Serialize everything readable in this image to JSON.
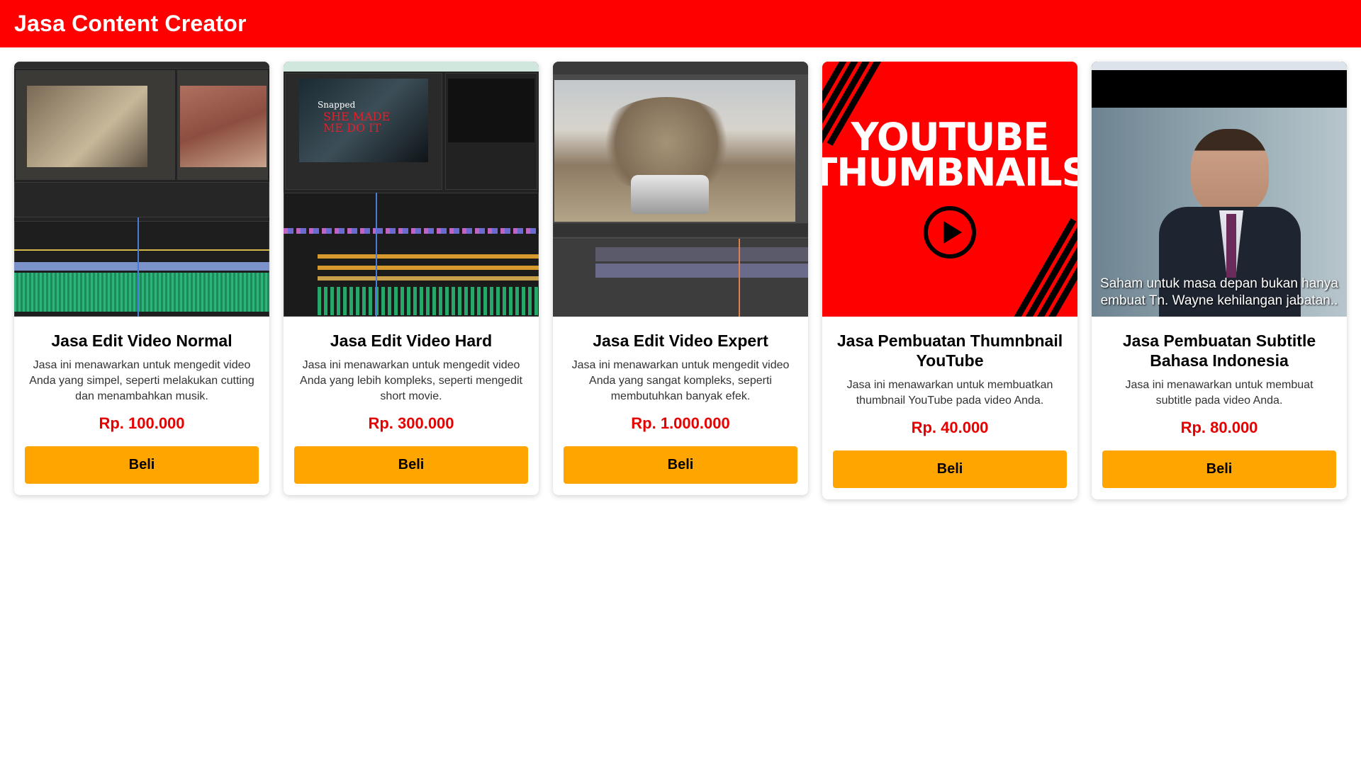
{
  "header": {
    "title": "Jasa Content Creator"
  },
  "colors": {
    "brand": "#ff0000",
    "price": "#e60000",
    "button": "#ffa500"
  },
  "products": [
    {
      "title": "Jasa Edit Video Normal",
      "description": "Jasa ini menawarkan untuk mengedit video Anda yang simpel, seperti melakukan cutting dan menambahkan musik.",
      "price": "Rp. 100.000",
      "button": "Beli",
      "image": "video-editor-screenshot"
    },
    {
      "title": "Jasa Edit Video Hard",
      "description": "Jasa ini menawarkan untuk mengedit video Anda yang lebih kompleks, seperti mengedit short movie.",
      "price": "Rp. 300.000",
      "button": "Beli",
      "image": "video-editor-screenshot",
      "image_text": [
        "Snapped",
        "SHE MADE ME DO IT"
      ]
    },
    {
      "title": "Jasa Edit Video Expert",
      "description": "Jasa ini menawarkan untuk mengedit video Anda yang sangat kompleks, seperti membutuhkan banyak efek.",
      "price": "Rp. 1.000.000",
      "button": "Beli",
      "image": "vfx-editor-screenshot"
    },
    {
      "title": "Jasa Pembuatan Thumnbnail YouTube",
      "description": "Jasa ini menawarkan untuk membuatkan thumbnail YouTube pada video Anda.",
      "price": "Rp. 40.000",
      "button": "Beli",
      "image": "youtube-thumbnails-graphic",
      "image_text": [
        "YOUTUBE",
        "THUMBNAILS"
      ]
    },
    {
      "title": "Jasa Pembuatan Subtitle Bahasa Indonesia",
      "description": "Jasa ini menawarkan untuk membuat subtitle pada video Anda.",
      "price": "Rp. 80.000",
      "button": "Beli",
      "image": "subtitled-movie-still",
      "image_text": [
        "Saham untuk masa depan bukan hanya",
        "embuat Tn. Wayne kehilangan jabatan.."
      ]
    }
  ]
}
